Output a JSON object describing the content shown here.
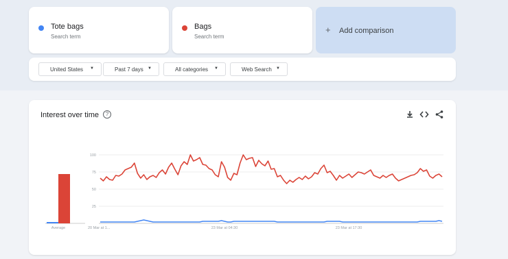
{
  "terms": [
    {
      "name": "Tote bags",
      "sub": "Search term",
      "color": "#4285f4"
    },
    {
      "name": "Bags",
      "sub": "Search term",
      "color": "#db4437"
    }
  ],
  "add_comparison": {
    "label": "Add comparison"
  },
  "filters": [
    {
      "label": "United States"
    },
    {
      "label": "Past 7 days"
    },
    {
      "label": "All categories"
    },
    {
      "label": "Web Search"
    }
  ],
  "chart": {
    "title": "Interest over time",
    "toolbar_icons": [
      "download-icon",
      "embed-icon",
      "share-icon"
    ]
  },
  "chart_data": {
    "type": "line",
    "ylim": [
      0,
      100
    ],
    "yticks": [
      "100",
      "75",
      "50",
      "25"
    ],
    "xtick_labels": [
      "20 Mar at 1...",
      "23 Mar at 04:30",
      "23 Mar at 17:30"
    ],
    "average_label": "Average",
    "grid": true,
    "averages": [
      {
        "name": "Tote bags",
        "value": 2,
        "color": "#4285f4"
      },
      {
        "name": "Bags",
        "value": 72,
        "color": "#db4437"
      }
    ],
    "series": [
      {
        "name": "Bags",
        "color": "#db4437",
        "values": [
          66,
          62,
          68,
          64,
          63,
          70,
          69,
          72,
          78,
          80,
          82,
          88,
          73,
          66,
          71,
          64,
          68,
          70,
          67,
          74,
          78,
          72,
          82,
          88,
          79,
          71,
          84,
          90,
          86,
          100,
          91,
          93,
          96,
          86,
          85,
          80,
          78,
          71,
          68,
          90,
          82,
          67,
          63,
          73,
          71,
          88,
          100,
          93,
          95,
          96,
          83,
          92,
          87,
          84,
          91,
          79,
          80,
          68,
          70,
          63,
          58,
          63,
          60,
          64,
          67,
          64,
          69,
          65,
          68,
          74,
          72,
          80,
          85,
          74,
          76,
          70,
          63,
          70,
          66,
          69,
          72,
          67,
          71,
          75,
          74,
          72,
          75,
          78,
          70,
          68,
          66,
          70,
          67,
          70,
          72,
          66,
          62,
          64,
          66,
          68,
          70,
          71,
          74,
          80,
          76,
          78,
          69,
          66,
          70,
          72,
          68
        ]
      },
      {
        "name": "Tote bags",
        "color": "#4285f4",
        "values": [
          2,
          2,
          2,
          2,
          2,
          2,
          2,
          2,
          2,
          2,
          2,
          2,
          3,
          4,
          5,
          4,
          3,
          2,
          2,
          2,
          2,
          2,
          2,
          2,
          2,
          2,
          2,
          2,
          2,
          2,
          2,
          2,
          2,
          3,
          3,
          3,
          3,
          3,
          3,
          4,
          3,
          2,
          2,
          3,
          3,
          3,
          3,
          3,
          3,
          3,
          3,
          3,
          3,
          3,
          3,
          3,
          3,
          2,
          2,
          2,
          2,
          2,
          2,
          2,
          2,
          2,
          2,
          2,
          2,
          2,
          2,
          2,
          2,
          3,
          3,
          3,
          3,
          3,
          2,
          2,
          2,
          2,
          2,
          2,
          2,
          2,
          2,
          2,
          2,
          2,
          2,
          2,
          2,
          2,
          2,
          2,
          2,
          2,
          2,
          2,
          2,
          2,
          2,
          3,
          3,
          3,
          3,
          3,
          3,
          4,
          3
        ]
      }
    ]
  }
}
